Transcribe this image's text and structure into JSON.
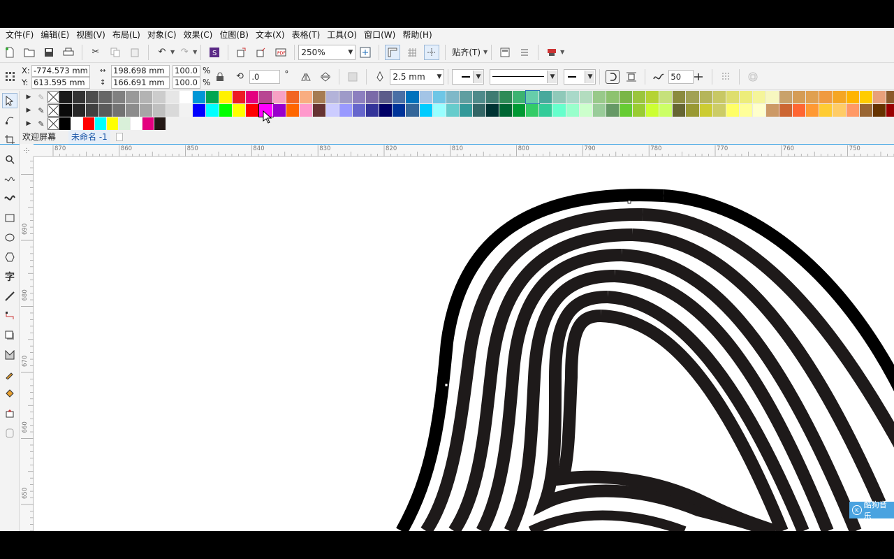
{
  "menu": [
    "文件(F)",
    "编辑(E)",
    "视图(V)",
    "布局(L)",
    "对象(C)",
    "效果(C)",
    "位图(B)",
    "文本(X)",
    "表格(T)",
    "工具(O)",
    "窗口(W)",
    "帮助(H)"
  ],
  "toolbar": {
    "zoom_value": "250%",
    "snap_label": "贴齐(T)"
  },
  "property_bar": {
    "x_label": "X:",
    "x_value": "-774.573 mm",
    "y_label": "Y:",
    "y_value": "613.595 mm",
    "width_value": "198.698 mm",
    "height_value": "166.691 mm",
    "scale_w": "100.0",
    "scale_h": "100.0",
    "percent": "%",
    "rotation": ".0",
    "degree": "°",
    "outline_width": "2.5 mm",
    "smoothing": "50"
  },
  "tabs": [
    "欢迎屏幕",
    "未命名 -1"
  ],
  "ruler_h_labels": [
    "870",
    "860",
    "850",
    "840",
    "830",
    "820",
    "810",
    "800",
    "790",
    "780",
    "770",
    "760",
    "750"
  ],
  "ruler_v_labels": [
    "690",
    "680",
    "670",
    "660",
    "650"
  ],
  "palette_row1": [
    "#1a1a1a",
    "#333333",
    "#4d4d4d",
    "#666666",
    "#808080",
    "#999999",
    "#b3b3b3",
    "#cccccc",
    "#e6e6e6",
    "#ffffff",
    "#0096d6",
    "#00a651",
    "#fff200",
    "#ed1c24",
    "#e4007f",
    "#b84592",
    "#f7a1c4",
    "#f26522",
    "#f9ad81",
    "#a67c52",
    "#b3b3d9",
    "#9e9ac8",
    "#8c7fbf",
    "#7a6aa8",
    "#5c5c8a",
    "#4a6fa5",
    "#0072bc",
    "#a3c4e6",
    "#6ec6e6",
    "#7fb8c8",
    "#5f9ea0",
    "#4e8a8a",
    "#3e7b72",
    "#2e8b57",
    "#3cb371",
    "#66cdaa",
    "#48a99c",
    "#8fc9b9",
    "#a9d9c9",
    "#b3dcbf",
    "#98c98a",
    "#8dc26f",
    "#7ab648",
    "#9bc53d",
    "#b5d334",
    "#c6e17b",
    "#8b8b3e",
    "#a1a154",
    "#b5b55a",
    "#c8c864",
    "#dede6e",
    "#eded7a",
    "#f5f59a",
    "#f7f7c0",
    "#c9a26b",
    "#d59c55",
    "#e0a050",
    "#f09a40",
    "#f5a623",
    "#ffb400",
    "#ffcc00",
    "#e8a07a",
    "#8b5a2b",
    "#a0522d"
  ],
  "palette_row2": [
    "#0a0a0a",
    "#262626",
    "#404040",
    "#5a5a5a",
    "#737373",
    "#8c8c8c",
    "#a6a6a6",
    "#bfbfbf",
    "#d9d9d9",
    "#f2f2f2",
    "#0000ff",
    "#00ffff",
    "#00ff00",
    "#ffff00",
    "#ff0000",
    "#ff00ff",
    "#9900cc",
    "#ff6600",
    "#ff99cc",
    "#663333",
    "#ccccff",
    "#9999ff",
    "#6666cc",
    "#333399",
    "#000066",
    "#003399",
    "#336699",
    "#00ccff",
    "#99ffff",
    "#66cccc",
    "#339999",
    "#336666",
    "#003333",
    "#006633",
    "#009933",
    "#33cc66",
    "#33cc99",
    "#66ffcc",
    "#99ffcc",
    "#ccffcc",
    "#99cc99",
    "#669966",
    "#66cc33",
    "#99cc33",
    "#ccff33",
    "#ccff66",
    "#666633",
    "#999933",
    "#cccc33",
    "#cccc66",
    "#ffff66",
    "#ffff99",
    "#ffffcc",
    "#cc9966",
    "#cc6633",
    "#ff6633",
    "#ff9933",
    "#ffcc33",
    "#ffcc66",
    "#ff9966",
    "#996633",
    "#663300",
    "#990000",
    "#cc0000"
  ],
  "palette_row3": [
    "#000000",
    "#ffffff",
    "#ff0000",
    "#00ffff",
    "#ffff00",
    "#d9f0d9",
    "#ffffff",
    "#e4007f",
    "#231815"
  ],
  "watermark": "酷狗音乐"
}
